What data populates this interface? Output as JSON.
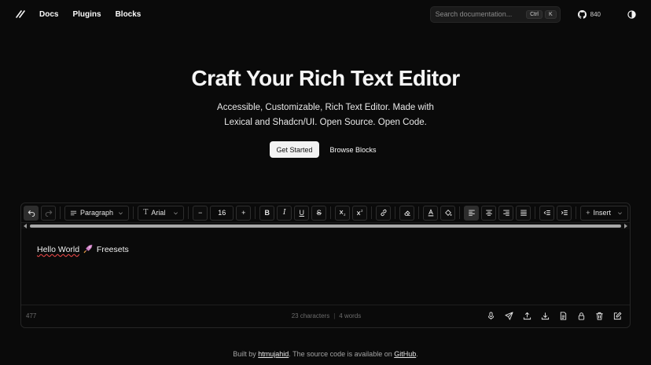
{
  "nav": {
    "items": [
      "Docs",
      "Plugins",
      "Blocks"
    ]
  },
  "search": {
    "placeholder": "Search documentation...",
    "kbd_ctrl": "Ctrl",
    "kbd_k": "K"
  },
  "github": {
    "stars": "840"
  },
  "hero": {
    "title": "Craft Your Rich Text Editor",
    "subtitle_line1": "Accessible, Customizable, Rich Text Editor. Made with",
    "subtitle_line2": "Lexical and Shadcn/UI. Open Source. Open Code.",
    "primary_btn": "Get Started",
    "secondary_btn": "Browse Blocks"
  },
  "toolbar": {
    "block_type": "Paragraph",
    "font_family": "Arial",
    "font_size": "16",
    "minus": "−",
    "plus": "+",
    "bold": "B",
    "italic": "I",
    "underline": "U",
    "strike": "S",
    "insert": "Insert"
  },
  "editor": {
    "content_word1": "Hello World",
    "content_word2": "Freesets",
    "left_count": "477",
    "characters": "23 characters",
    "words": "4 words"
  },
  "footer": {
    "prefix": "Built by ",
    "author": "htmujahid",
    "middle": ". The source code is available on ",
    "repo": "GitHub",
    "suffix": "."
  }
}
